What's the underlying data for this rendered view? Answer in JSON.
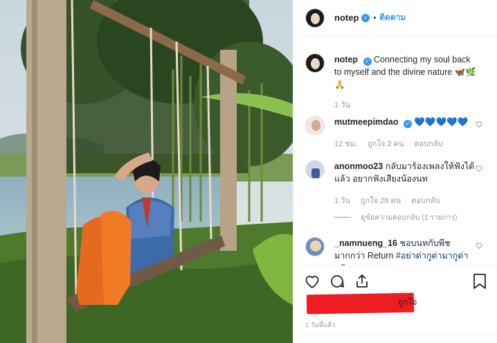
{
  "post": {
    "username": "notep",
    "follow_label": "ติดตาม",
    "dot": "•",
    "verified_mark": "✓"
  },
  "caption": {
    "username": "notep",
    "text": "Connecting my soul back to myself and the divine nature 🦋🌿🙏",
    "time": "1 วัน"
  },
  "comments": [
    {
      "username": "mutmeepimdao",
      "text": "💙💙💙💙💙",
      "time": "12 ชม.",
      "likes": "ถูกใจ 2 คน",
      "reply": "ตอบกลับ"
    },
    {
      "username": "anonmoo23",
      "text": "กลับมาร้องเพลงให้ฟังได้แล้ว อยากฟังเสียงน้องนท",
      "time": "1 วัน",
      "likes": "ถูกใจ 28 คน",
      "reply": "ตอบกลับ",
      "view_replies": "ดูข้อความตอบกลับ (1 รายการ)"
    },
    {
      "username": "_namnueng_16",
      "text_plain": "ชอบนทกับพีชมากกว่า Return ",
      "hashtag": "#อย่าด่ากูด่ามากูด่ากลับ"
    }
  ],
  "likes_visible_text": "ถูกใจ",
  "post_time": "1 วันที่แล้ว",
  "icons": [
    "heart-icon",
    "comment-icon",
    "share-icon",
    "bookmark-icon"
  ],
  "colors": {
    "link": "#3897f0",
    "redaction": "#ee1d23",
    "muted": "#999999"
  }
}
